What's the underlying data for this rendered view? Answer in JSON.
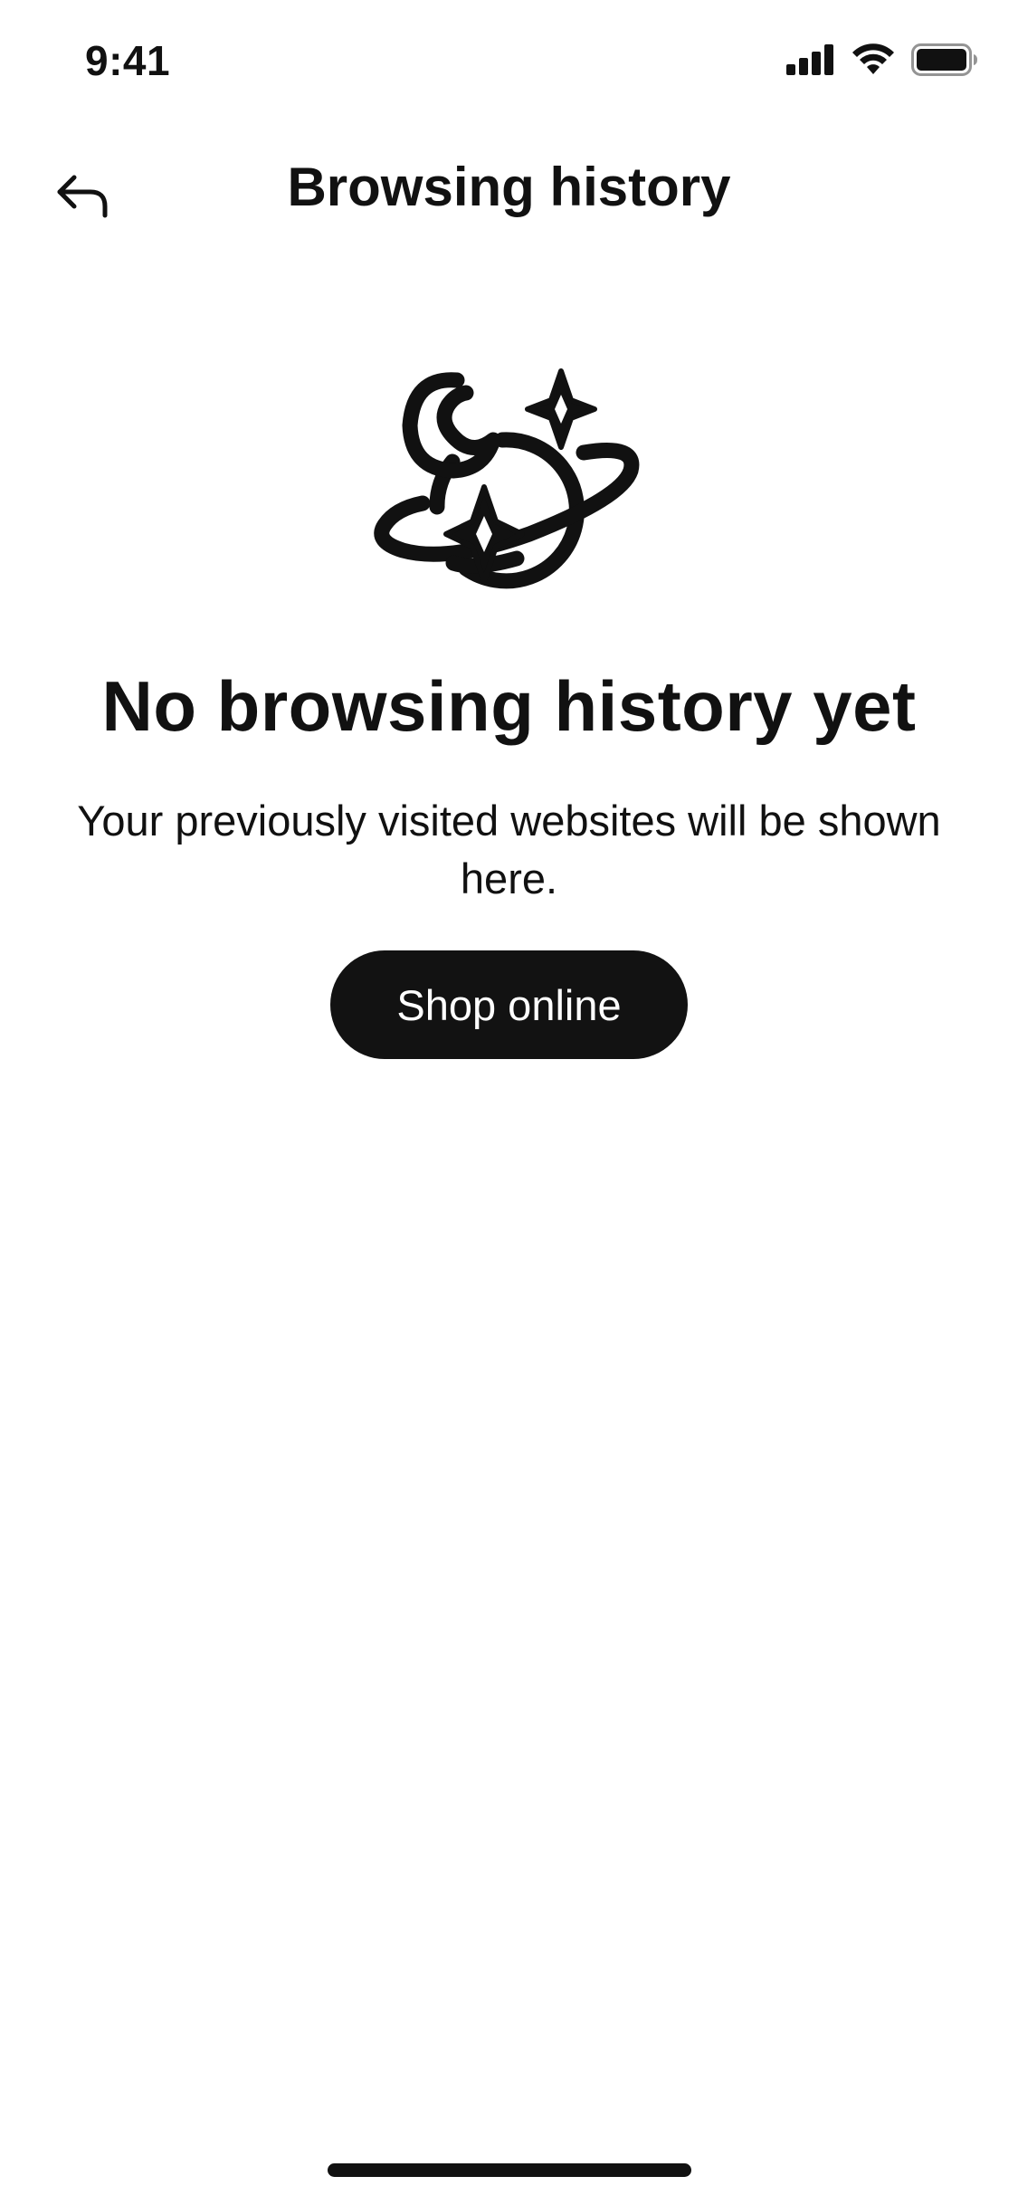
{
  "status_bar": {
    "time": "9:41",
    "icons": [
      "cellular-signal-icon",
      "wifi-icon",
      "battery-icon"
    ]
  },
  "header": {
    "title": "Browsing history",
    "back_icon": "back-arrow-icon"
  },
  "empty_state": {
    "illustration_icon": "planet-moon-sparkle-icon",
    "title": "No browsing history yet",
    "description": "Your previously visited websites will be shown here.",
    "button_label": "Shop online"
  },
  "colors": {
    "text": "#111111",
    "button_background": "#121212",
    "button_text": "#ffffff",
    "background": "#ffffff"
  }
}
